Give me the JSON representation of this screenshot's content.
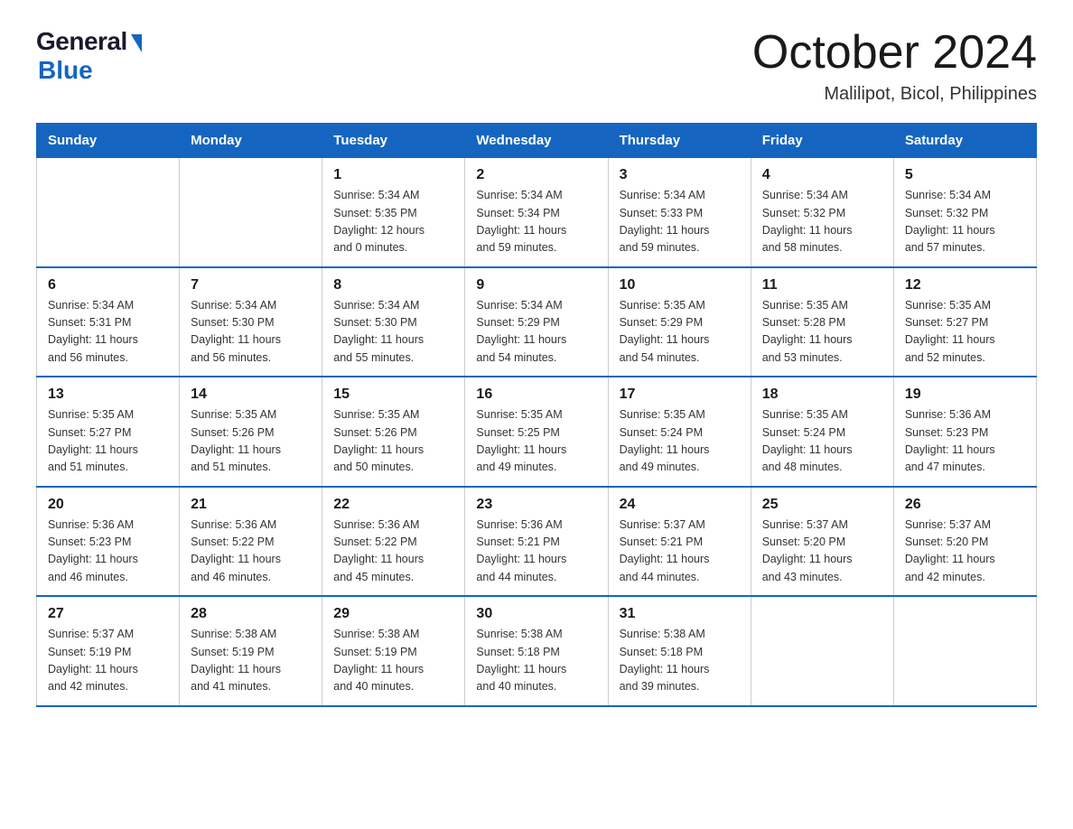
{
  "logo": {
    "general": "General",
    "blue": "Blue"
  },
  "title": {
    "month_year": "October 2024",
    "location": "Malilipot, Bicol, Philippines"
  },
  "headers": [
    "Sunday",
    "Monday",
    "Tuesday",
    "Wednesday",
    "Thursday",
    "Friday",
    "Saturday"
  ],
  "weeks": [
    [
      {
        "day": "",
        "info": ""
      },
      {
        "day": "",
        "info": ""
      },
      {
        "day": "1",
        "info": "Sunrise: 5:34 AM\nSunset: 5:35 PM\nDaylight: 12 hours\nand 0 minutes."
      },
      {
        "day": "2",
        "info": "Sunrise: 5:34 AM\nSunset: 5:34 PM\nDaylight: 11 hours\nand 59 minutes."
      },
      {
        "day": "3",
        "info": "Sunrise: 5:34 AM\nSunset: 5:33 PM\nDaylight: 11 hours\nand 59 minutes."
      },
      {
        "day": "4",
        "info": "Sunrise: 5:34 AM\nSunset: 5:32 PM\nDaylight: 11 hours\nand 58 minutes."
      },
      {
        "day": "5",
        "info": "Sunrise: 5:34 AM\nSunset: 5:32 PM\nDaylight: 11 hours\nand 57 minutes."
      }
    ],
    [
      {
        "day": "6",
        "info": "Sunrise: 5:34 AM\nSunset: 5:31 PM\nDaylight: 11 hours\nand 56 minutes."
      },
      {
        "day": "7",
        "info": "Sunrise: 5:34 AM\nSunset: 5:30 PM\nDaylight: 11 hours\nand 56 minutes."
      },
      {
        "day": "8",
        "info": "Sunrise: 5:34 AM\nSunset: 5:30 PM\nDaylight: 11 hours\nand 55 minutes."
      },
      {
        "day": "9",
        "info": "Sunrise: 5:34 AM\nSunset: 5:29 PM\nDaylight: 11 hours\nand 54 minutes."
      },
      {
        "day": "10",
        "info": "Sunrise: 5:35 AM\nSunset: 5:29 PM\nDaylight: 11 hours\nand 54 minutes."
      },
      {
        "day": "11",
        "info": "Sunrise: 5:35 AM\nSunset: 5:28 PM\nDaylight: 11 hours\nand 53 minutes."
      },
      {
        "day": "12",
        "info": "Sunrise: 5:35 AM\nSunset: 5:27 PM\nDaylight: 11 hours\nand 52 minutes."
      }
    ],
    [
      {
        "day": "13",
        "info": "Sunrise: 5:35 AM\nSunset: 5:27 PM\nDaylight: 11 hours\nand 51 minutes."
      },
      {
        "day": "14",
        "info": "Sunrise: 5:35 AM\nSunset: 5:26 PM\nDaylight: 11 hours\nand 51 minutes."
      },
      {
        "day": "15",
        "info": "Sunrise: 5:35 AM\nSunset: 5:26 PM\nDaylight: 11 hours\nand 50 minutes."
      },
      {
        "day": "16",
        "info": "Sunrise: 5:35 AM\nSunset: 5:25 PM\nDaylight: 11 hours\nand 49 minutes."
      },
      {
        "day": "17",
        "info": "Sunrise: 5:35 AM\nSunset: 5:24 PM\nDaylight: 11 hours\nand 49 minutes."
      },
      {
        "day": "18",
        "info": "Sunrise: 5:35 AM\nSunset: 5:24 PM\nDaylight: 11 hours\nand 48 minutes."
      },
      {
        "day": "19",
        "info": "Sunrise: 5:36 AM\nSunset: 5:23 PM\nDaylight: 11 hours\nand 47 minutes."
      }
    ],
    [
      {
        "day": "20",
        "info": "Sunrise: 5:36 AM\nSunset: 5:23 PM\nDaylight: 11 hours\nand 46 minutes."
      },
      {
        "day": "21",
        "info": "Sunrise: 5:36 AM\nSunset: 5:22 PM\nDaylight: 11 hours\nand 46 minutes."
      },
      {
        "day": "22",
        "info": "Sunrise: 5:36 AM\nSunset: 5:22 PM\nDaylight: 11 hours\nand 45 minutes."
      },
      {
        "day": "23",
        "info": "Sunrise: 5:36 AM\nSunset: 5:21 PM\nDaylight: 11 hours\nand 44 minutes."
      },
      {
        "day": "24",
        "info": "Sunrise: 5:37 AM\nSunset: 5:21 PM\nDaylight: 11 hours\nand 44 minutes."
      },
      {
        "day": "25",
        "info": "Sunrise: 5:37 AM\nSunset: 5:20 PM\nDaylight: 11 hours\nand 43 minutes."
      },
      {
        "day": "26",
        "info": "Sunrise: 5:37 AM\nSunset: 5:20 PM\nDaylight: 11 hours\nand 42 minutes."
      }
    ],
    [
      {
        "day": "27",
        "info": "Sunrise: 5:37 AM\nSunset: 5:19 PM\nDaylight: 11 hours\nand 42 minutes."
      },
      {
        "day": "28",
        "info": "Sunrise: 5:38 AM\nSunset: 5:19 PM\nDaylight: 11 hours\nand 41 minutes."
      },
      {
        "day": "29",
        "info": "Sunrise: 5:38 AM\nSunset: 5:19 PM\nDaylight: 11 hours\nand 40 minutes."
      },
      {
        "day": "30",
        "info": "Sunrise: 5:38 AM\nSunset: 5:18 PM\nDaylight: 11 hours\nand 40 minutes."
      },
      {
        "day": "31",
        "info": "Sunrise: 5:38 AM\nSunset: 5:18 PM\nDaylight: 11 hours\nand 39 minutes."
      },
      {
        "day": "",
        "info": ""
      },
      {
        "day": "",
        "info": ""
      }
    ]
  ]
}
